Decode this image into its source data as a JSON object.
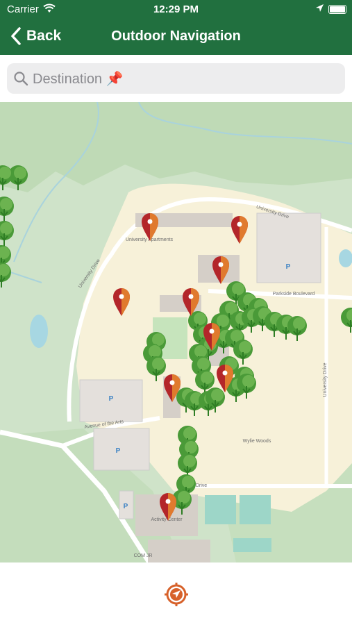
{
  "status_bar": {
    "carrier": "Carrier",
    "time": "12:29 PM"
  },
  "nav": {
    "back_label": "Back",
    "title": "Outdoor Navigation"
  },
  "search": {
    "placeholder": "Destination 📌"
  },
  "map": {
    "street_labels": [
      "University Drive",
      "University Drive",
      "Parkside Boulevard",
      "Avenue of the Arts",
      "University Drive",
      "Drive",
      "Wylie Woods",
      "University Apartments",
      "Activity Center",
      "COM JR"
    ],
    "parking_label": "P",
    "marker_count": 9
  },
  "colors": {
    "brand_green": "#21703f",
    "marker_red": "#b3262a",
    "marker_orange": "#e07a2e",
    "locate_blue": "#1d4a78"
  }
}
